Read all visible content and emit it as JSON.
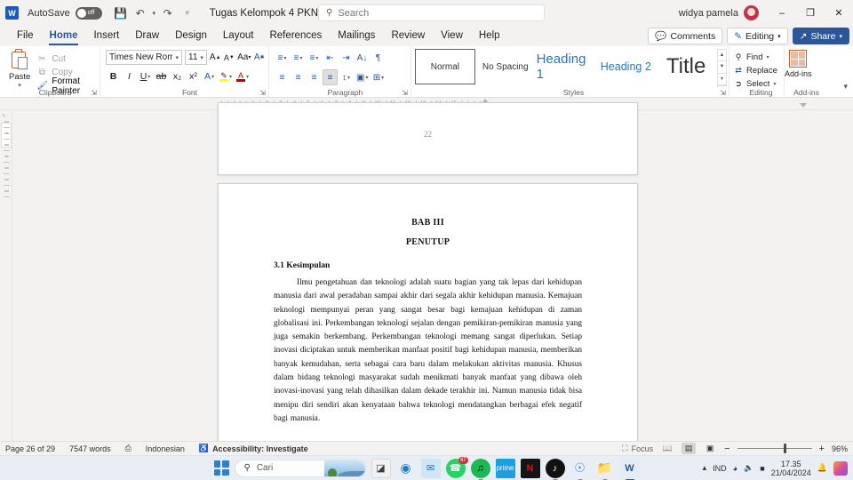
{
  "titlebar": {
    "app_icon": "word-logo-icon",
    "autosave_label": "AutoSave",
    "autosave_state": "off",
    "save_icon": "save-icon",
    "undo_icon": "undo-icon",
    "redo_icon": "redo-icon",
    "customize_icon": "customize-quick-access-icon",
    "document_title": "Tugas Kelompok 4 PKN",
    "title_chevron": "chevron-down-icon",
    "search_placeholder": "Search",
    "search_value": "",
    "search_icon": "search-icon",
    "user_name": "widya pamela",
    "minimize": "–",
    "restore": "❐",
    "close": "✕"
  },
  "ribbon_tabs": {
    "items": [
      {
        "label": "File",
        "active": false
      },
      {
        "label": "Home",
        "active": true
      },
      {
        "label": "Insert",
        "active": false
      },
      {
        "label": "Draw",
        "active": false
      },
      {
        "label": "Design",
        "active": false
      },
      {
        "label": "Layout",
        "active": false
      },
      {
        "label": "References",
        "active": false
      },
      {
        "label": "Mailings",
        "active": false
      },
      {
        "label": "Review",
        "active": false
      },
      {
        "label": "View",
        "active": false
      },
      {
        "label": "Help",
        "active": false
      }
    ],
    "comments_label": "Comments",
    "editing_label": "Editing",
    "share_label": "Share"
  },
  "clipboard": {
    "group_label": "Clipboard",
    "paste_label": "Paste",
    "cut_label": "Cut",
    "copy_label": "Copy",
    "format_painter_label": "Format Painter"
  },
  "font": {
    "group_label": "Font",
    "family_value": "Times New Roman",
    "size_value": "11",
    "grow_font": "A",
    "shrink_font": "A",
    "change_case": "Aa",
    "clear_formatting": "A",
    "bold": "B",
    "italic": "I",
    "underline": "U",
    "strikethrough": "ab",
    "subscript": "x₂",
    "superscript": "x²",
    "text_effects": "A",
    "highlight": "✎",
    "font_color": "A",
    "font_color_hex": "#c00000",
    "highlight_hex": "#ffff00"
  },
  "paragraph": {
    "group_label": "Paragraph",
    "bullets": "≡",
    "numbering": "≡",
    "multilevel": "≡",
    "decrease_indent": "⇤",
    "increase_indent": "⇥",
    "sort": "A↓",
    "show_marks": "¶",
    "align_left": "≡",
    "align_center": "≡",
    "align_right": "≡",
    "justify": "≡",
    "line_spacing": "↕",
    "shading": "▣",
    "borders": "⊞"
  },
  "styles": {
    "group_label": "Styles",
    "items": [
      {
        "label": "Normal",
        "selected": true
      },
      {
        "label": "No Spacing",
        "selected": false
      },
      {
        "label": "Heading 1",
        "selected": false
      },
      {
        "label": "Heading 2",
        "selected": false
      },
      {
        "label": "Title",
        "selected": false
      }
    ]
  },
  "editing": {
    "group_label": "Editing",
    "find_label": "Find",
    "replace_label": "Replace",
    "select_label": "Select"
  },
  "addins": {
    "group_label": "Add-ins",
    "button_label": "Add-ins"
  },
  "ruler": {
    "ticks": "· | · | · | · | · | · 1 · | · 2 · | · 3 · | · 4 · | · 5 · | · 6 · | · 7 · | · 8 · | · 9 · | ·10 · | ·11 · | ·12 · | ·13 · | ·14 · | ·15 · | · | · | · |",
    "tab_stop": "L"
  },
  "document": {
    "previous_page_number": "22",
    "heading": "BAB III",
    "subheading": "PENUTUP",
    "section_title": "3.1 Kesimpulan",
    "paragraph": "Ilmu pengetahuan dan teknologi adalah suatu bagian yang tak lepas dari kehidupan manusia dari awal peradaban sampai akhir dari segala akhir kehidupan manusia. Kemajuan teknologi mempunyai peran yang sangat besar bagi kemajuan kehidupan di zaman globalisasi ini. Perkembangan teknologi sejalan dengan pemikiran-pemikiran manusia yang juga semakin berkembang. Perkembangan teknologi memang sangat diperlukan. Setiap inovasi diciptakan untuk memberikan manfaat positif bagi kehidupan manusia, memberikan banyak kemudahan, serta sebagai cara baru dalam melakukan aktivitas manusia. Khusus dalam bidang teknologi masyarakat sudah menikmati banyak manfaat yang dibawa oleh inovasi-inovasi yang telah dihasilkan dalam dekade terakhir ini. Namun manusia tidak bisa menipu diri sendiri akan kenyataan bahwa teknologi mendatangkan berbagai efek negatif bagi manusia."
  },
  "statusbar": {
    "page_info": "Page 26 of 29",
    "word_count": "7547 words",
    "proofing_icon": "proofing-icon",
    "language": "Indonesian",
    "accessibility": "Accessibility: Investigate",
    "focus_label": "Focus",
    "read_mode_icon": "read-mode-icon",
    "print_layout_icon": "print-layout-icon",
    "web_layout_icon": "web-layout-icon",
    "zoom_out": "−",
    "zoom_in": "+",
    "zoom_level": "96%"
  },
  "taskbar": {
    "start_icon": "windows-start-icon",
    "search_placeholder": "Cari",
    "search_icon": "search-icon",
    "apps": [
      {
        "name": "file-explorer",
        "glyph": "◰",
        "bg": "#f2f2f2",
        "fg": "#3a3a3a",
        "running": false,
        "badge": ""
      },
      {
        "name": "microsoft-edge",
        "glyph": "◔",
        "bg": "#ffffff",
        "fg": "#1b7fc4",
        "running": false,
        "badge": ""
      },
      {
        "name": "mail",
        "glyph": "✉",
        "bg": "#cfe6f5",
        "fg": "#1b6ec2",
        "running": false,
        "badge": ""
      },
      {
        "name": "whatsapp",
        "glyph": "✆",
        "bg": "#25d366",
        "fg": "#ffffff",
        "running": false,
        "badge": "47"
      },
      {
        "name": "spotify",
        "glyph": "♫",
        "bg": "#1db954",
        "fg": "#000000",
        "running": true,
        "badge": ""
      },
      {
        "name": "amazon-prime-video",
        "glyph": "▶",
        "bg": "#1d9fe0",
        "fg": "#ffffff",
        "running": false,
        "badge": ""
      },
      {
        "name": "netflix",
        "glyph": "N",
        "bg": "#141414",
        "fg": "#e50914",
        "running": false,
        "badge": ""
      },
      {
        "name": "tiktok",
        "glyph": "♪",
        "bg": "#111111",
        "fg": "#ffffff",
        "running": true,
        "badge": ""
      },
      {
        "name": "google-chrome",
        "glyph": "◉",
        "bg": "#ffffff",
        "fg": "#4285f4",
        "running": true,
        "badge": ""
      },
      {
        "name": "file-explorer-folder",
        "glyph": "▬",
        "bg": "#f7c948",
        "fg": "#e0a800",
        "running": true,
        "badge": ""
      },
      {
        "name": "microsoft-word",
        "glyph": "W",
        "bg": "#ffffff",
        "fg": "#2b579a",
        "running": true,
        "badge": ""
      }
    ],
    "tray": {
      "show_hidden_icon": "chevron-up-icon",
      "language": "IND",
      "wifi_icon": "wifi-icon",
      "volume_icon": "volume-icon",
      "battery_icon": "battery-icon",
      "time": "17.35",
      "date": "21/04/2024",
      "notification_icon": "bell-icon",
      "copilot_icon": "copilot-icon"
    }
  }
}
